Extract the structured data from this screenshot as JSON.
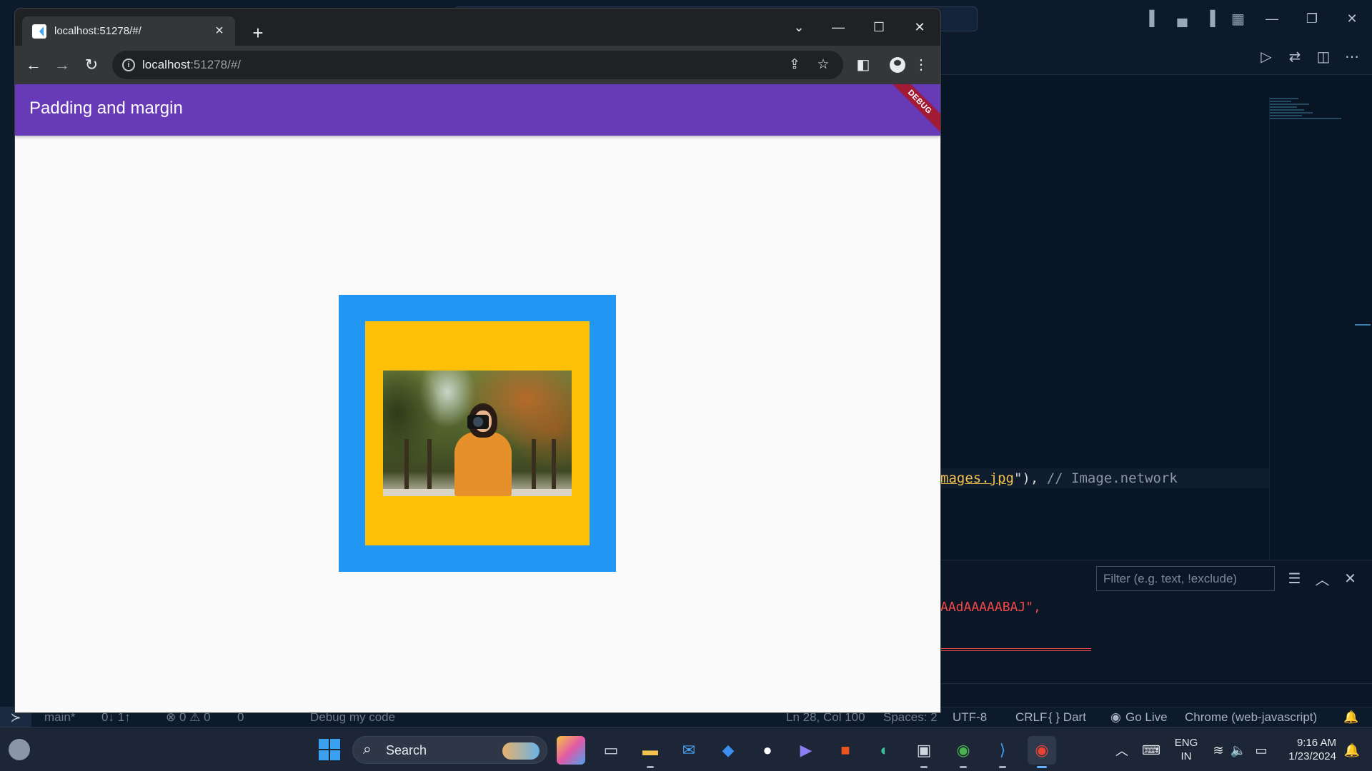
{
  "browser": {
    "tab_title": "localhost:51278/#/",
    "url_host": "localhost",
    "url_rest": ":51278/#/",
    "new_tab_symbol": "+"
  },
  "app": {
    "title": "Padding and margin",
    "debug_banner": "DEBUG",
    "colors": {
      "appbar": "#673ab7",
      "outer_container": "#2196f3",
      "inner_container": "#ffc107",
      "background": "#fafafa"
    },
    "image_description_icon": "photo-woman-with-camera"
  },
  "editor": {
    "code_string": "mages.jpg",
    "code_punct": "\"),",
    "code_comment": "// Image.network",
    "panel_filter_placeholder": "Filter (e.g. text, !exclude)",
    "panel_output_text": "AAdAAAAABAJ\","
  },
  "statusbar": {
    "branch": "main*",
    "sync": "0↓ 1↑",
    "problems": "⊗ 0 ⚠ 0",
    "ports": "0",
    "debug": "Debug my code",
    "position": "Ln 28, Col 100",
    "spaces": "Spaces: 2",
    "encoding": "UTF-8",
    "eol": "CRLF",
    "language": "{ } Dart",
    "golive": "Go Live",
    "target": "Chrome (web-javascript)"
  },
  "taskbar": {
    "search_label": "Search",
    "lang_top": "ENG",
    "lang_bottom": "IN",
    "time": "9:16 AM",
    "date": "1/23/2024"
  }
}
